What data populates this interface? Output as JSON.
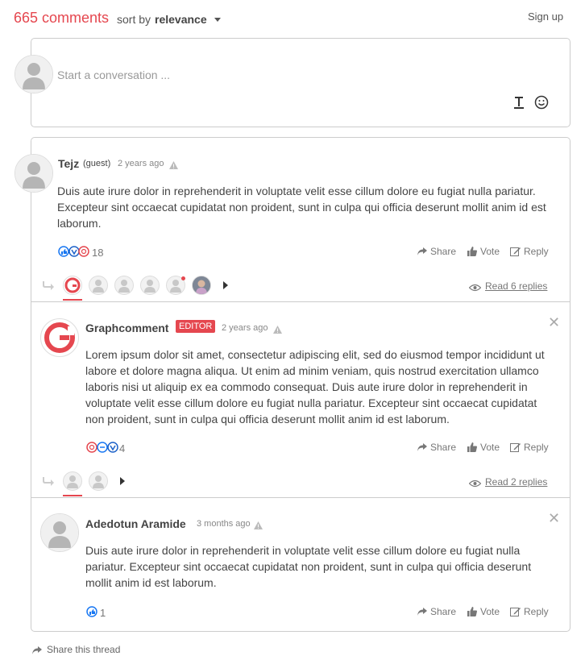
{
  "header": {
    "comments_count": "665 comments",
    "sort_by_label": "sort by",
    "sort_value": "relevance",
    "sign_up": "Sign up"
  },
  "composer": {
    "placeholder": "Start a conversation ..."
  },
  "comments": [
    {
      "author": "Tejz",
      "guest_tag": "(guest)",
      "time": "2 years ago",
      "body": "Duis aute irure dolor in reprehenderit in voluptate velit esse cillum dolore eu fugiat nulla pariatur. Excepteur sint occaecat cupidatat non proident, sunt in culpa qui officia deserunt mollit anim id est laborum.",
      "reactions": "18",
      "read_replies": "Read 6 replies"
    },
    {
      "author": "Graphcomment",
      "badge": "EDITOR",
      "time": "2 years ago",
      "body": "Lorem ipsum dolor sit amet, consectetur adipiscing elit, sed do eiusmod tempor incididunt ut labore et dolore magna aliqua. Ut enim ad minim veniam, quis nostrud exercitation ullamco laboris nisi ut aliquip ex ea commodo consequat. Duis aute irure dolor in reprehenderit in voluptate velit esse cillum dolore eu fugiat nulla pariatur. Excepteur sint occaecat cupidatat non proident, sunt in culpa qui officia deserunt mollit anim id est laborum.",
      "reactions": "4",
      "read_replies": "Read 2 replies"
    },
    {
      "author": "Adedotun Aramide",
      "time": "3 months ago",
      "body": "Duis aute irure dolor in reprehenderit in voluptate velit esse cillum dolore eu fugiat nulla pariatur. Excepteur sint occaecat cupidatat non proident, sunt in culpa qui officia deserunt mollit anim id est laborum.",
      "reactions": "1"
    }
  ],
  "actions": {
    "share": "Share",
    "vote": "Vote",
    "reply": "Reply"
  },
  "footer": {
    "share_thread": "Share this thread"
  },
  "colors": {
    "accent": "#e5474f",
    "text": "#444444",
    "muted": "#777777"
  }
}
